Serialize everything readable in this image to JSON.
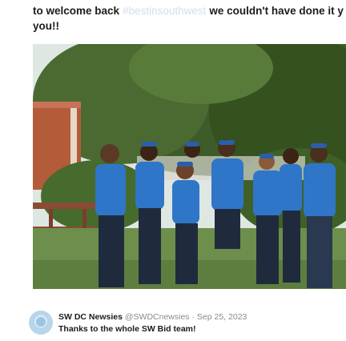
{
  "post": {
    "line1_part1": "to welcome back",
    "hashtag": "#bestinsouthwest",
    "line1_part2": "we couldn't have done it y",
    "line2": "you!!"
  },
  "photo": {
    "subject": "group-photo",
    "shirt_color": "#2f76c9",
    "tree_color": "#3e5b2a",
    "building_color": "#b45b3a"
  },
  "quoted_tweet": {
    "author_name": "SW DC Newsies",
    "handle": "@SWDCnewsies",
    "separator": "·",
    "date": "Sep 25, 2023",
    "text": "Thanks to the whole SW Bid team!"
  }
}
